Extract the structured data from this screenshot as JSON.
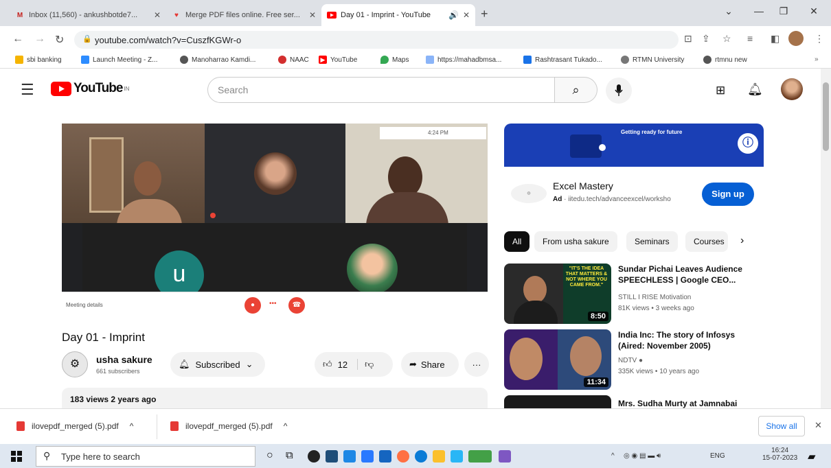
{
  "browser": {
    "tabs": [
      {
        "title": "Inbox (11,560) - ankushbotde7...",
        "icon": "gmail-icon",
        "color": "#c5221f"
      },
      {
        "title": "Merge PDF files online. Free ser...",
        "icon": "pdf-icon",
        "color": "#e53935"
      },
      {
        "title": "Day 01 - Imprint - YouTube",
        "icon": "youtube-icon",
        "color": "#ff0000"
      }
    ],
    "url": "youtube.com/watch?v=CuszfKGWr-o",
    "bookmarks": [
      {
        "label": "sbi banking",
        "color": "#f5b400"
      },
      {
        "label": "Launch Meeting - Z...",
        "color": "#2d8cff"
      },
      {
        "label": "Manoharrao Kamdi...",
        "color": "#555555"
      },
      {
        "label": "NAAC",
        "color": "#d32f2f"
      },
      {
        "label": "YouTube",
        "color": "#ff0000"
      },
      {
        "label": "Maps",
        "color": "#34a853"
      },
      {
        "label": "https://mahadbmsa...",
        "color": "#8ab4f8"
      },
      {
        "label": "Rashtrasant Tukado...",
        "color": "#1a73e8"
      },
      {
        "label": "RTMN University",
        "color": "#777777"
      },
      {
        "label": "rtmnu new",
        "color": "#555555"
      }
    ]
  },
  "youtube": {
    "logo_text": "YouTube",
    "logo_sup": "IN",
    "search_placeholder": "Search",
    "video": {
      "title": "Day 01 - Imprint",
      "channel": "usha sakure",
      "subscribers": "661 subscribers",
      "subscribed_label": "Subscribed",
      "likes": "12",
      "share_label": "Share",
      "views_time": "183 views  2 years ago",
      "meeting_time": "4:24 PM",
      "meeting_details": "Meeting details",
      "participant_initial": "u"
    },
    "ad": {
      "banner_text": "Getting ready for future",
      "title": "Excel Mastery",
      "ad_label": "Ad",
      "url": "iitedu.tech/advanceexcel/worksho",
      "cta": "Sign up"
    },
    "chips": [
      "All",
      "From usha sakure",
      "Seminars",
      "Courses"
    ],
    "recommendations": [
      {
        "title": "Sundar Pichai Leaves Audience SPEECHLESS | Google CEO...",
        "channel": "STILL I RISE Motivation",
        "meta": "81K views • 3 weeks ago",
        "duration": "8:50",
        "thumb_text": "\"IT'S THE IDEA THAT MATTERS & NOT WHERE YOU CAME FROM.\""
      },
      {
        "title": "India Inc: The story of Infosys (Aired: November 2005)",
        "channel": "NDTV",
        "meta": "335K views • 10 years ago",
        "duration": "11:34",
        "thumb_text": ""
      },
      {
        "title": "Mrs. Sudha Murty at Jamnabai",
        "channel": "",
        "meta": "",
        "duration": "",
        "thumb_text": ""
      }
    ]
  },
  "downloads": {
    "items": [
      "ilovepdf_merged (5).pdf",
      "ilovepdf_merged (5).pdf"
    ],
    "show_all": "Show all"
  },
  "taskbar": {
    "search_placeholder": "Type here to search",
    "lang": "ENG",
    "time": "16:24",
    "date": "15-07-2023"
  }
}
